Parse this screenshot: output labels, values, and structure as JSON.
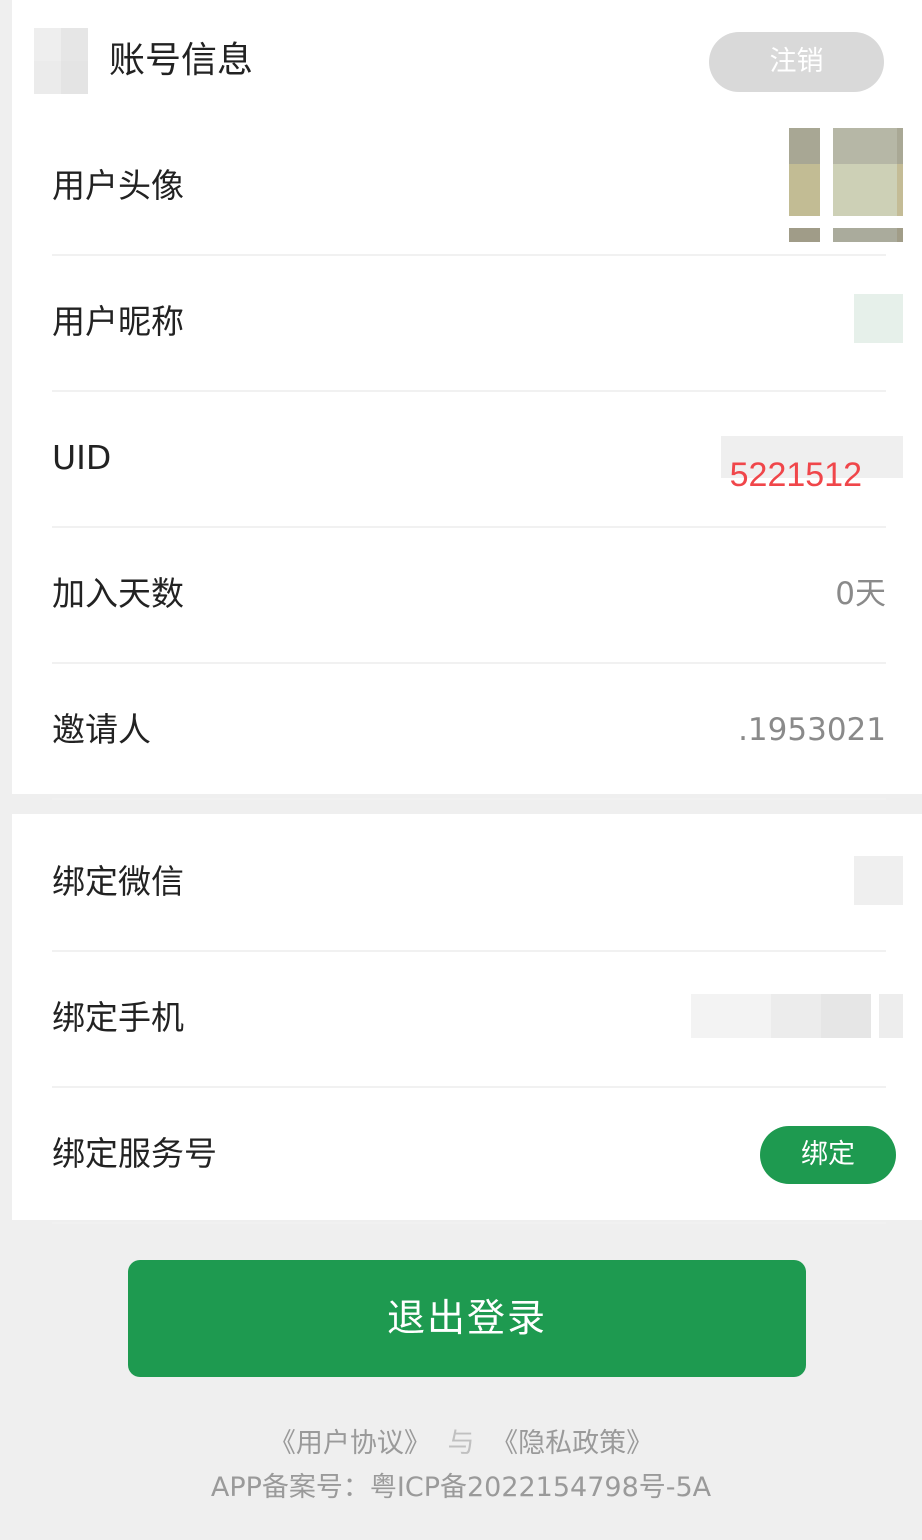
{
  "header": {
    "title": "账号信息",
    "cancel_label": "注销"
  },
  "section1": {
    "rows": [
      {
        "label": "用户头像"
      },
      {
        "label": "用户昵称"
      },
      {
        "label": "UID",
        "value": "5221512"
      },
      {
        "label": "加入天数",
        "value": "0天"
      },
      {
        "label": "邀请人",
        "value": ".1953021"
      }
    ]
  },
  "section2": {
    "rows": [
      {
        "label": "绑定微信"
      },
      {
        "label": "绑定手机"
      },
      {
        "label": "绑定服务号",
        "button": "绑定"
      }
    ]
  },
  "logout_label": "退出登录",
  "footer": {
    "user_agreement": "《用户协议》",
    "connector": "与",
    "privacy_policy": "《隐私政策》",
    "icp": "APP备案号：粤ICP备2022154798号-5A"
  },
  "colors": {
    "accent_green": "#1e9a50",
    "uid_red": "#f0464a"
  }
}
